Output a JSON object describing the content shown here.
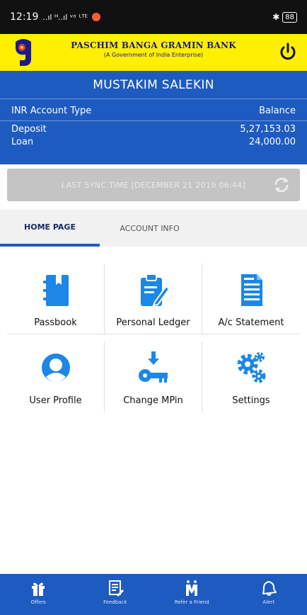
{
  "status_bar": {
    "time": "12:19",
    "signal_text": "..ıl ᴴ..ıl ᵛᵒ ᴸᵀᴱ",
    "battery": "88"
  },
  "header": {
    "bank_name": "PASCHIM BANGA GRAMIN BANK",
    "bank_subtitle": "(A Government of India Enterprise)",
    "logo_icon": "bank-logo",
    "power_icon": "power-icon"
  },
  "account": {
    "user_name": "MUSTAKIM SALEKIN",
    "type_label": "INR Account Type",
    "balance_label": "Balance",
    "rows": [
      {
        "type": "Deposit",
        "balance": "5,27,153.03"
      },
      {
        "type": "Loan",
        "balance": "24,000.00"
      }
    ]
  },
  "sync": {
    "text": "LAST SYNC TIME  [DECEMBER 21 2019 06:44]",
    "icon": "refresh-icon"
  },
  "tabs": [
    {
      "label": "HOME PAGE",
      "active": true
    },
    {
      "label": "ACCOUNT INFO",
      "active": false
    }
  ],
  "menu": [
    {
      "label": "Passbook",
      "icon": "passbook-icon"
    },
    {
      "label": "Personal Ledger",
      "icon": "clipboard-edit-icon"
    },
    {
      "label": "A/c Statement",
      "icon": "statement-icon"
    },
    {
      "label": "User Profile",
      "icon": "user-profile-icon"
    },
    {
      "label": "Change MPin",
      "icon": "key-icon"
    },
    {
      "label": "Settings",
      "icon": "gears-icon"
    }
  ],
  "bottom_nav": [
    {
      "label": "Offers",
      "icon": "gift-icon"
    },
    {
      "label": "Feedback",
      "icon": "feedback-icon"
    },
    {
      "label": "Refer a Friend",
      "icon": "refer-icon"
    },
    {
      "label": "Alert",
      "icon": "bell-icon"
    }
  ],
  "colors": {
    "header_yellow": "#ffef00",
    "primary_blue": "#1e5bc0",
    "icon_blue": "#1b87e6",
    "sync_grey": "#c4c4c4"
  }
}
